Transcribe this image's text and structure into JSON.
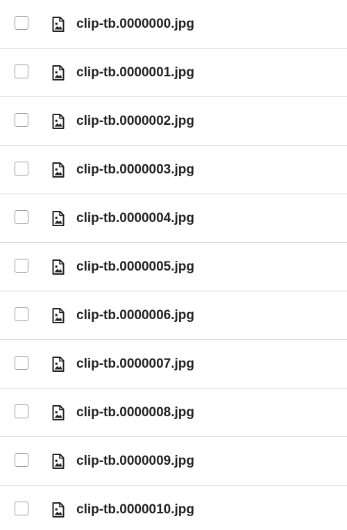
{
  "file_list": {
    "items": [
      {
        "name": "clip-tb.0000000.jpg",
        "icon": "image-file-icon",
        "checked": false
      },
      {
        "name": "clip-tb.0000001.jpg",
        "icon": "image-file-icon",
        "checked": false
      },
      {
        "name": "clip-tb.0000002.jpg",
        "icon": "image-file-icon",
        "checked": false
      },
      {
        "name": "clip-tb.0000003.jpg",
        "icon": "image-file-icon",
        "checked": false
      },
      {
        "name": "clip-tb.0000004.jpg",
        "icon": "image-file-icon",
        "checked": false
      },
      {
        "name": "clip-tb.0000005.jpg",
        "icon": "image-file-icon",
        "checked": false
      },
      {
        "name": "clip-tb.0000006.jpg",
        "icon": "image-file-icon",
        "checked": false
      },
      {
        "name": "clip-tb.0000007.jpg",
        "icon": "image-file-icon",
        "checked": false
      },
      {
        "name": "clip-tb.0000008.jpg",
        "icon": "image-file-icon",
        "checked": false
      },
      {
        "name": "clip-tb.0000009.jpg",
        "icon": "image-file-icon",
        "checked": false
      },
      {
        "name": "clip-tb.0000010.jpg",
        "icon": "image-file-icon",
        "checked": false
      }
    ]
  }
}
